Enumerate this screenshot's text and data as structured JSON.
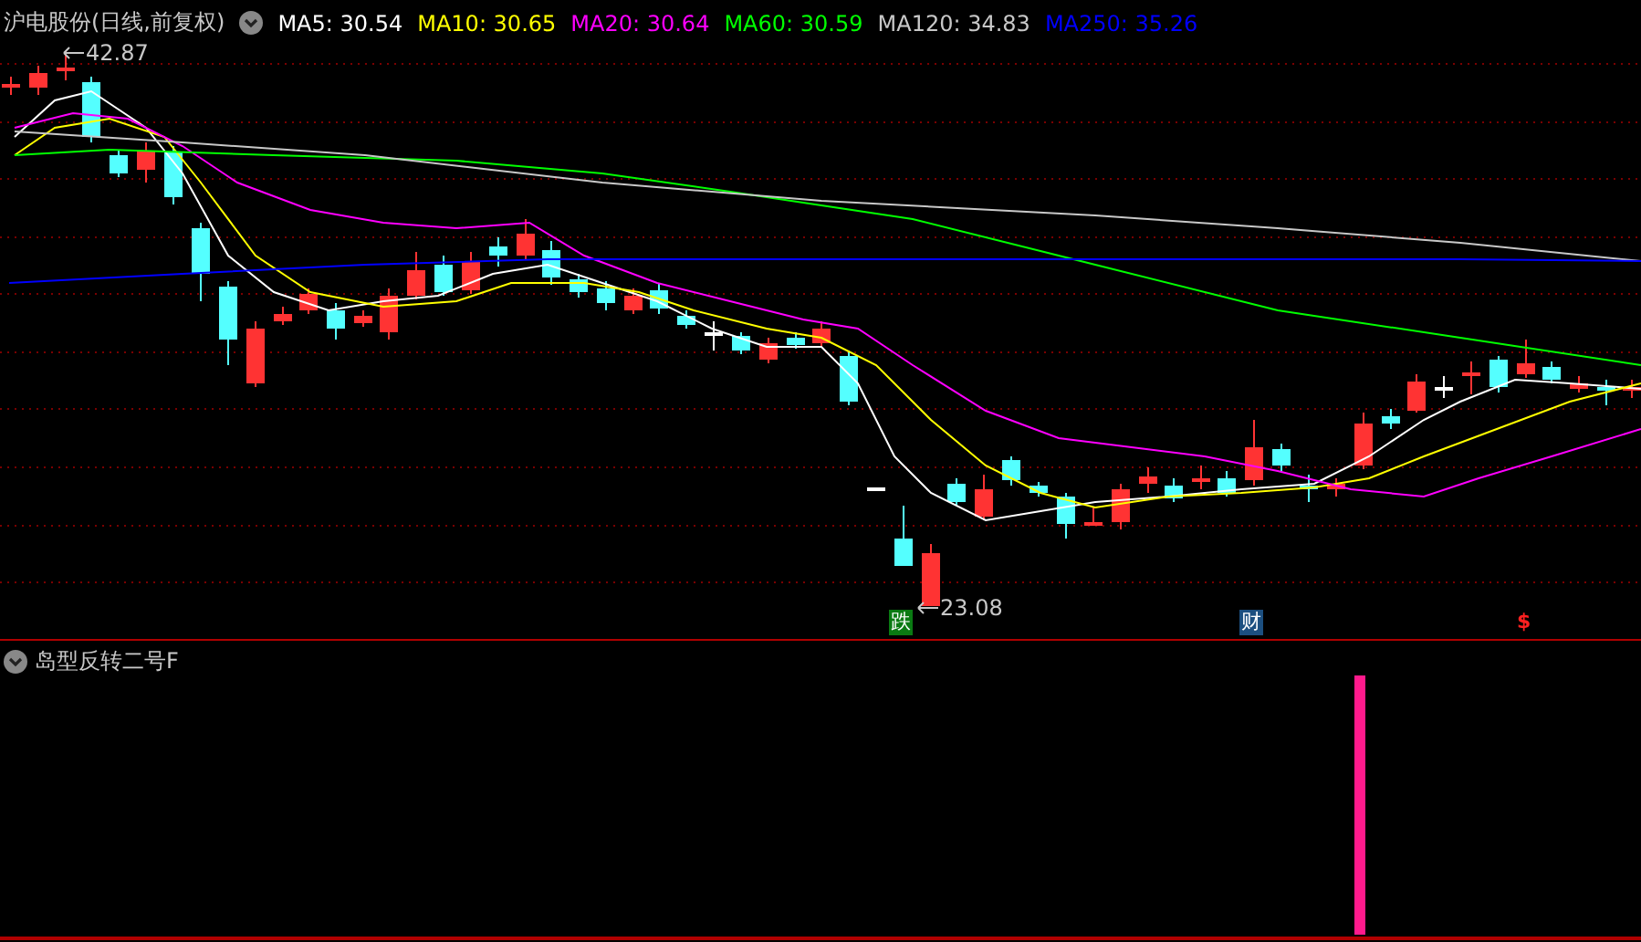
{
  "title": "沪电股份(日线,前复权)",
  "ma_legend": [
    {
      "label": "MA5: 30.54",
      "color": "#ffffff"
    },
    {
      "label": "MA10: 30.65",
      "color": "#ffff00"
    },
    {
      "label": "MA20: 30.64",
      "color": "#ff00ff"
    },
    {
      "label": "MA60: 30.59",
      "color": "#00ff00"
    },
    {
      "label": "MA120: 34.83",
      "color": "#c8c8c8"
    },
    {
      "label": "MA250: 35.26",
      "color": "#0000ff"
    }
  ],
  "price_labels": [
    {
      "kind": "high",
      "text": "42.87"
    },
    {
      "kind": "low",
      "text": "23.08"
    }
  ],
  "markers": [
    {
      "kind": "fall",
      "text": "跌"
    },
    {
      "kind": "finance",
      "text": "财"
    },
    {
      "kind": "dollar",
      "text": "$"
    }
  ],
  "indicator": {
    "title": "岛型反转二号F"
  }
}
